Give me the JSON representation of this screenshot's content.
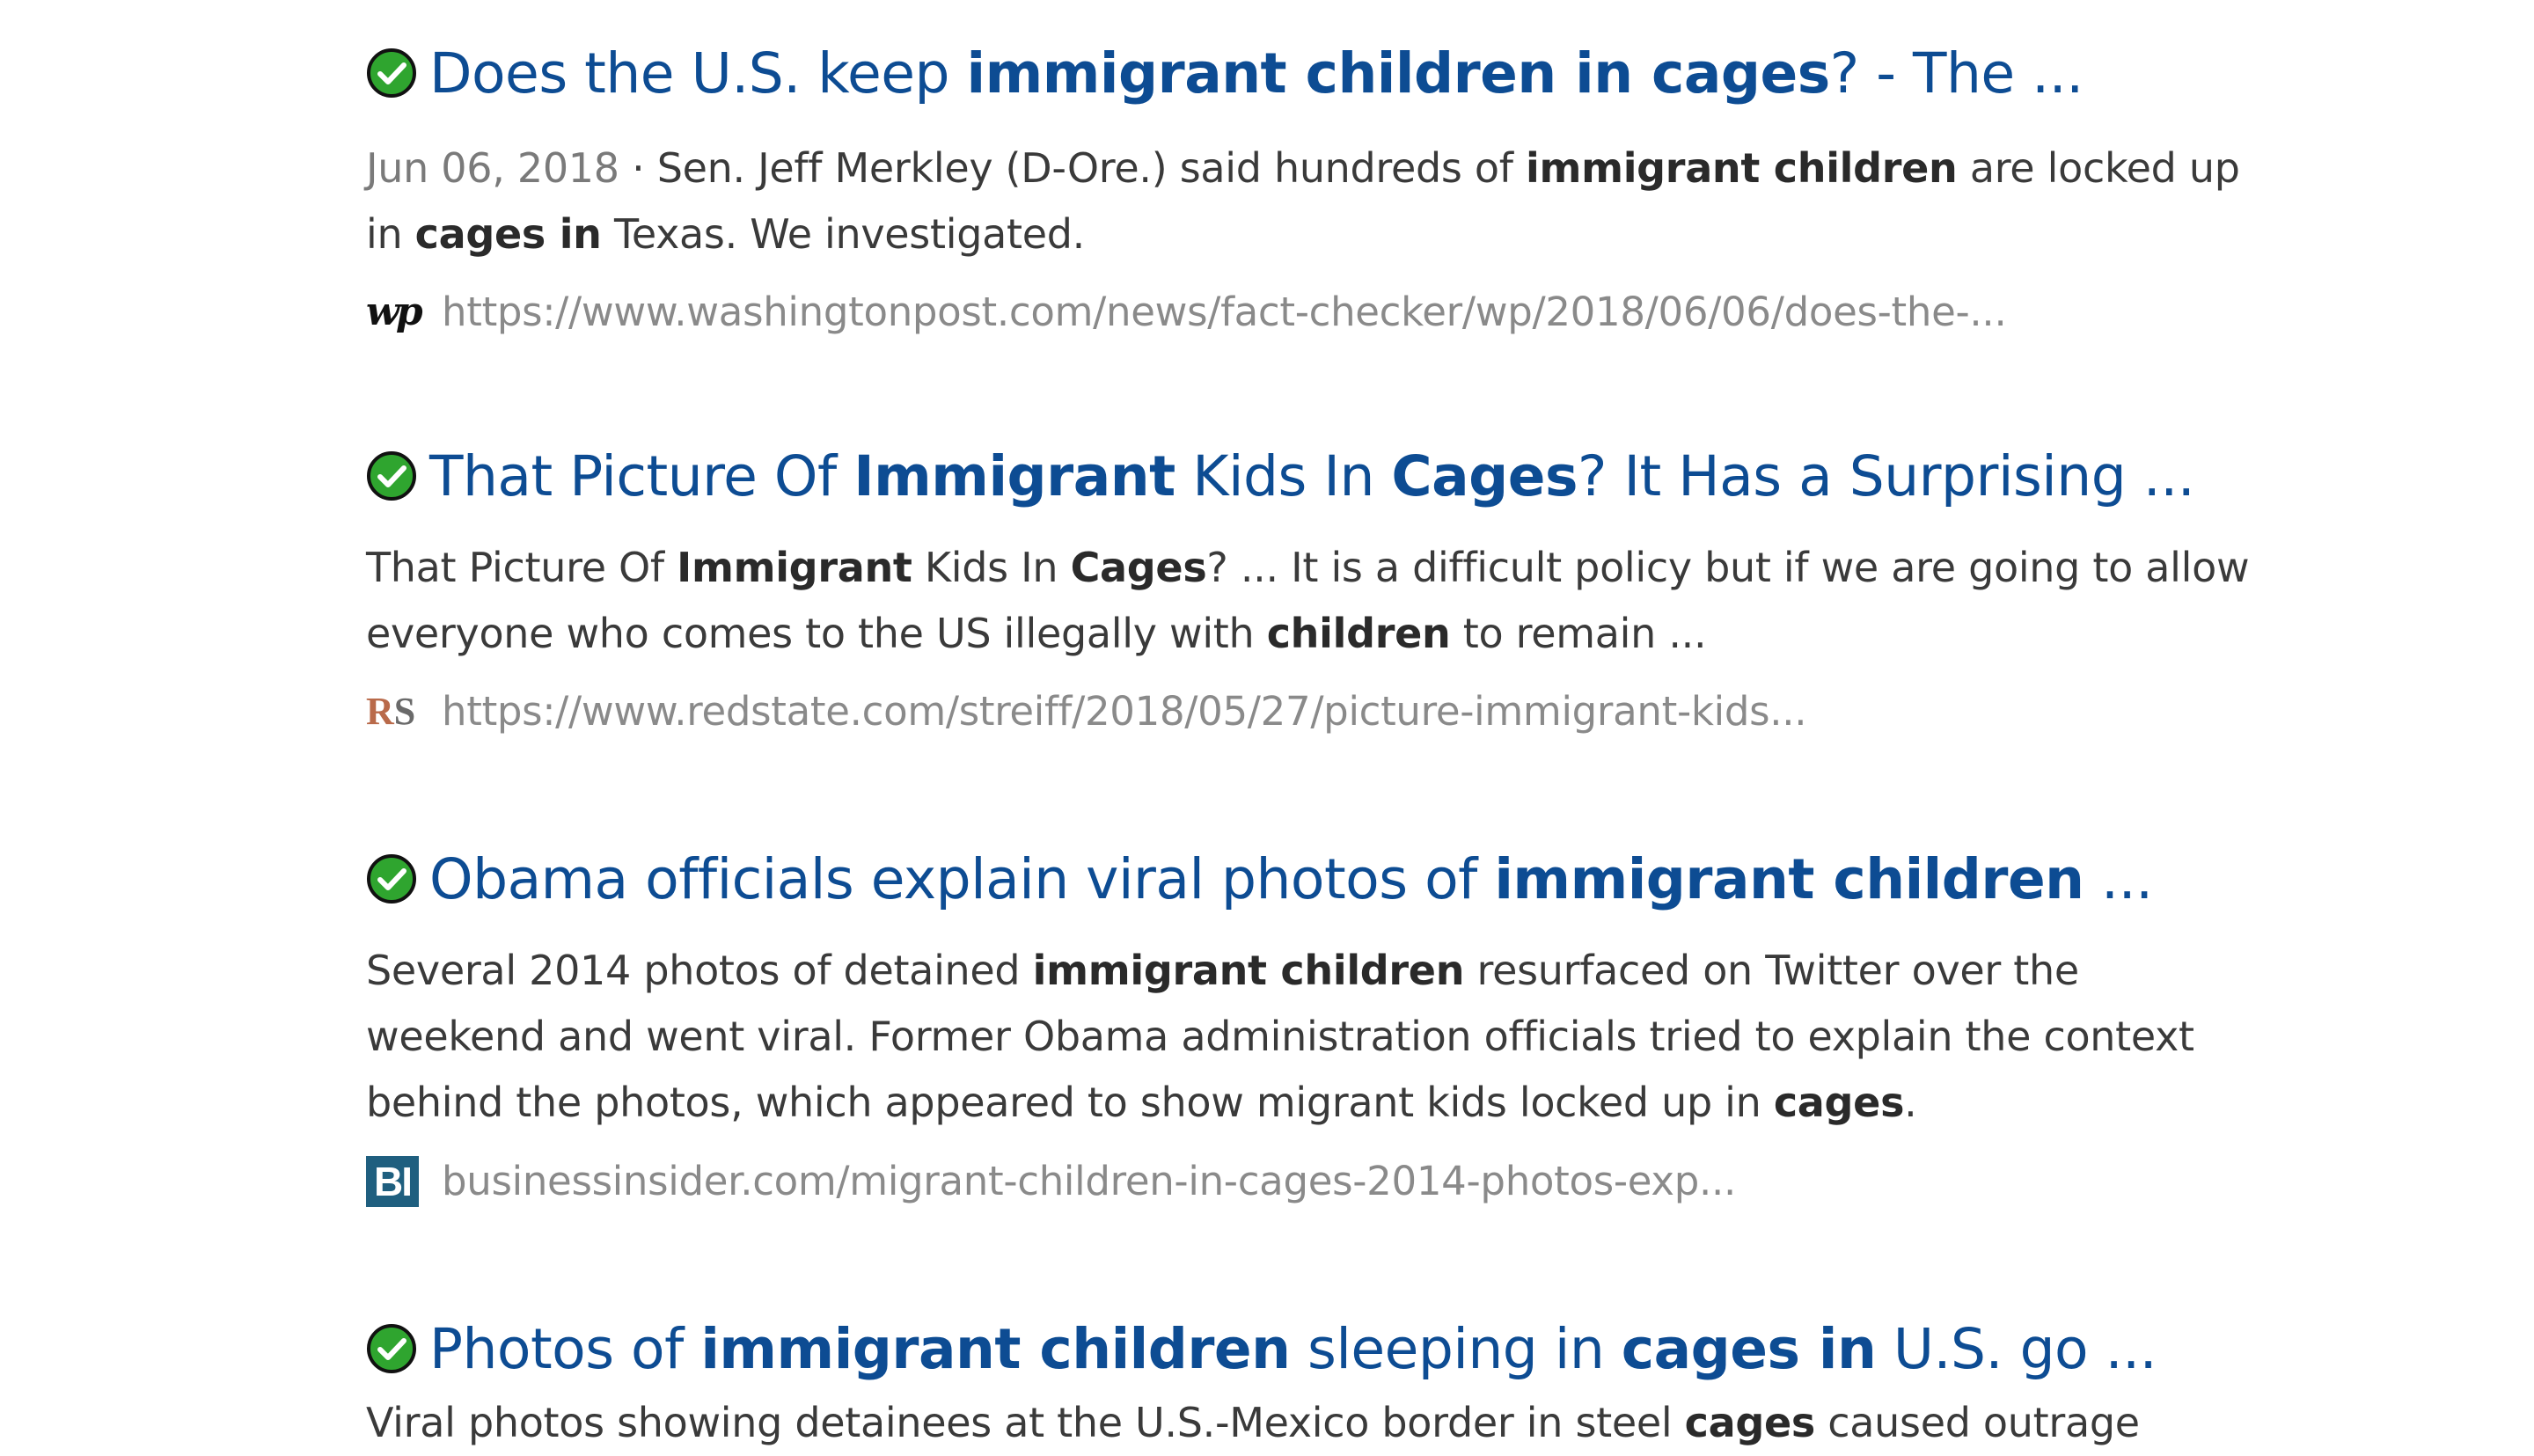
{
  "results": [
    {
      "title_parts": [
        {
          "t": "Does the U.S. keep ",
          "b": false
        },
        {
          "t": "immigrant children in cages",
          "b": true
        },
        {
          "t": "? - The ...",
          "b": false
        }
      ],
      "date": "Jun 06, 2018",
      "snippet_parts": [
        {
          "t": " · Sen. Jeff Merkley (D-Ore.) said hundreds of ",
          "b": false
        },
        {
          "t": "immigrant children",
          "b": true
        },
        {
          "t": " are locked up in ",
          "b": false
        },
        {
          "t": "cages in",
          "b": true
        },
        {
          "t": " Texas. We investigated.",
          "b": false
        }
      ],
      "favicon": "wp",
      "favicon_text": "wp",
      "url": "https://www.washingtonpost.com/news/fact-checker/wp/2018/06/06/does-the-...",
      "verified_icon": "green-check-icon"
    },
    {
      "title_parts": [
        {
          "t": "That Picture Of ",
          "b": false
        },
        {
          "t": "Immigrant",
          "b": true
        },
        {
          "t": " Kids In ",
          "b": false
        },
        {
          "t": "Cages",
          "b": true
        },
        {
          "t": "? It Has a Surprising ...",
          "b": false
        }
      ],
      "date": "",
      "snippet_parts": [
        {
          "t": "That Picture Of ",
          "b": false
        },
        {
          "t": "Immigrant",
          "b": true
        },
        {
          "t": " Kids In ",
          "b": false
        },
        {
          "t": "Cages",
          "b": true
        },
        {
          "t": "? ... It is a difficult policy but if we are going to allow everyone who comes to the US illegally with ",
          "b": false
        },
        {
          "t": "children",
          "b": true
        },
        {
          "t": " to remain ...",
          "b": false
        }
      ],
      "favicon": "rs",
      "favicon_text": "RS",
      "url": "https://www.redstate.com/streiff/2018/05/27/picture-immigrant-kids...",
      "verified_icon": "green-check-icon"
    },
    {
      "title_parts": [
        {
          "t": "Obama officials explain viral photos of ",
          "b": false
        },
        {
          "t": "immigrant children",
          "b": true
        },
        {
          "t": " ...",
          "b": false
        }
      ],
      "date": "",
      "snippet_parts": [
        {
          "t": "Several 2014 photos of detained ",
          "b": false
        },
        {
          "t": "immigrant children",
          "b": true
        },
        {
          "t": " resurfaced on Twitter over the weekend and went viral. Former Obama administration officials tried to explain the context behind the photos, which appeared to show migrant kids locked up in ",
          "b": false
        },
        {
          "t": "cages",
          "b": true
        },
        {
          "t": ".",
          "b": false
        }
      ],
      "favicon": "bi",
      "favicon_text": "BI",
      "url": "businessinsider.com/migrant-children-in-cages-2014-photos-exp...",
      "verified_icon": "green-check-icon"
    },
    {
      "title_parts": [
        {
          "t": "Photos of ",
          "b": false
        },
        {
          "t": "immigrant children",
          "b": true
        },
        {
          "t": " sleeping in ",
          "b": false
        },
        {
          "t": "cages in",
          "b": true
        },
        {
          "t": " U.S. go ...",
          "b": false
        }
      ],
      "date": "",
      "snippet_parts": [
        {
          "t": "Viral photos showing detainees at the U.S.-Mexico border in steel ",
          "b": false
        },
        {
          "t": "cages",
          "b": true
        },
        {
          "t": " caused outrage",
          "b": false
        }
      ],
      "favicon": "",
      "favicon_text": "",
      "url": "",
      "verified_icon": "green-check-icon"
    }
  ],
  "colors": {
    "title": "#0d4c93",
    "snippet": "#3a3a3a",
    "url": "#8a8a8a",
    "check": "#2fa52f"
  }
}
